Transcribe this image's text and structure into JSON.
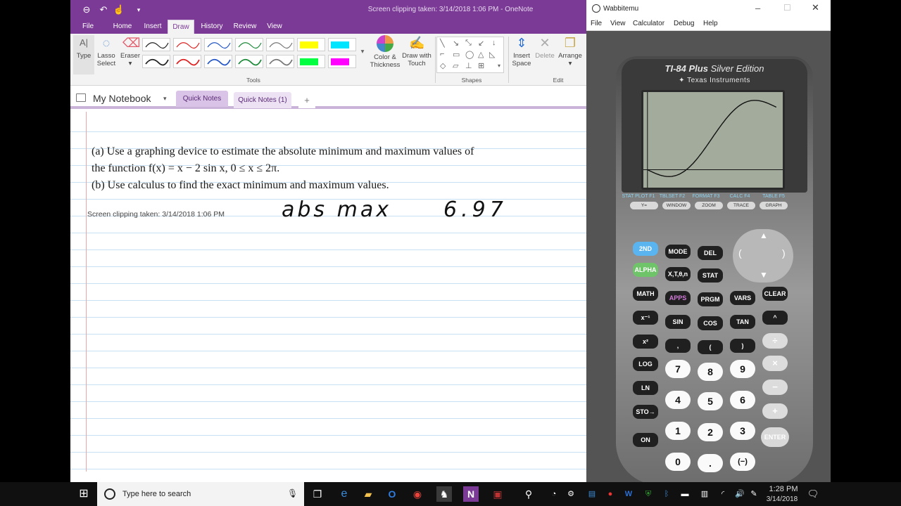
{
  "onenote": {
    "window_title": "Screen clipping taken: 3/14/2018 1:06 PM - OneNote",
    "ribbon_tabs": [
      "File",
      "Home",
      "Insert",
      "Draw",
      "History",
      "Review",
      "View"
    ],
    "tools": {
      "type": "Type",
      "lasso_1": "Lasso",
      "lasso_2": "Select",
      "eraser": "Eraser",
      "color_1": "Color &",
      "color_2": "Thickness",
      "drawtouch_1": "Draw with",
      "drawtouch_2": "Touch",
      "insert_1": "Insert",
      "insert_2": "Space",
      "delete": "Delete",
      "arrange": "Arrange"
    },
    "group_labels": {
      "tools": "Tools",
      "shapes": "Shapes",
      "edit": "Edit"
    },
    "notebook": "My Notebook",
    "section_tabs": [
      "Quick Notes",
      "Quick Notes (1)"
    ],
    "add_tab": "+",
    "problem": {
      "line_a": "(a)  Use a graphing device to estimate the absolute minimum and maximum values of",
      "line_b": "the function f(x) = x − 2 sin x, 0 ≤ x ≤ 2π.",
      "line_c": "(b)  Use calculus to find the exact minimum and maximum values."
    },
    "clip_note": "Screen clipping taken: 3/14/2018 1:06 PM",
    "handwriting": {
      "label": "abs max",
      "value": "6.97"
    },
    "colors": {
      "accent": "#7b3a96",
      "section_tab": "#d9c3e6"
    }
  },
  "wabbit": {
    "window_title": "Wabbitemu",
    "menu": [
      "File",
      "View",
      "Calculator",
      "Debug",
      "Help"
    ],
    "model_bold": "TI-84 Plus",
    "model_rest": "Silver Edition",
    "brand": "Texas Instruments",
    "fkey_labels": [
      "STAT PLOT F1",
      "TBLSET F2",
      "FORMAT F3",
      "CALC F4",
      "TABLE F5"
    ],
    "fkeys": [
      "Y=",
      "WINDOW",
      "ZOOM",
      "TRACE",
      "GRAPH"
    ],
    "keys": {
      "row1": [
        "2ND",
        "MODE",
        "DEL"
      ],
      "row2": [
        "ALPHA",
        "X,T,θ,n",
        "STAT"
      ],
      "row3": [
        "MATH",
        "APPS",
        "PRGM",
        "VARS",
        "CLEAR"
      ],
      "row4": [
        "x⁻¹",
        "SIN",
        "COS",
        "TAN",
        "^"
      ],
      "row5": [
        "x²",
        ",",
        "(",
        ")",
        "÷"
      ],
      "log": "LOG",
      "ln": "LN",
      "sto": "STO→",
      "on": "ON",
      "nums1": [
        "7",
        "8",
        "9"
      ],
      "nums2": [
        "4",
        "5",
        "6"
      ],
      "nums3": [
        "1",
        "2",
        "3"
      ],
      "nums4": [
        "0",
        ".",
        "(−)"
      ],
      "mul": "×",
      "minus": "−",
      "plus": "+",
      "enter": "ENTER"
    },
    "graph_function": "x - 2 sin x"
  },
  "taskbar": {
    "search_placeholder": "Type here to search",
    "time": "1:28 PM",
    "date": "3/14/2018"
  }
}
